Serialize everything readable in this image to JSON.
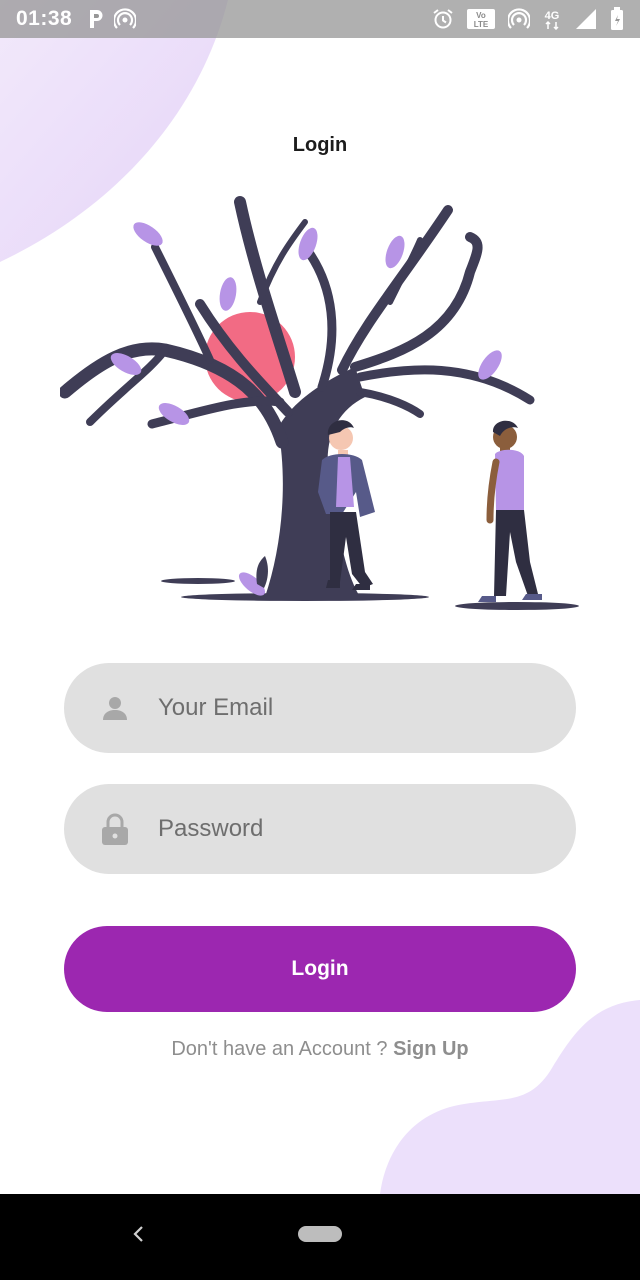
{
  "status_bar": {
    "time": "01:38",
    "left_icons": [
      "parking-app-icon",
      "hotspot-icon"
    ],
    "right_icons": [
      "alarm-icon",
      "volte-icon",
      "hotspot-icon",
      "4g-icon",
      "signal-icon",
      "battery-icon"
    ],
    "volte_label": "Vo LTE",
    "network_label": "4G"
  },
  "screen": {
    "title": "Login",
    "illustration": "tree-with-two-people-illustration"
  },
  "form": {
    "email": {
      "placeholder": "Your Email",
      "value": "",
      "icon": "person-icon"
    },
    "password": {
      "placeholder": "Password",
      "value": "",
      "icon": "lock-icon"
    },
    "login_label": "Login",
    "signup_prompt": "Don't have an Account ? ",
    "signup_link": "Sign Up"
  },
  "colors": {
    "accent": "#9c27b0",
    "field_bg": "#e0e0e0",
    "blob": "#ece0fb",
    "tree": "#3f3d56",
    "leaf": "#b794e6",
    "sun": "#f26b84"
  }
}
